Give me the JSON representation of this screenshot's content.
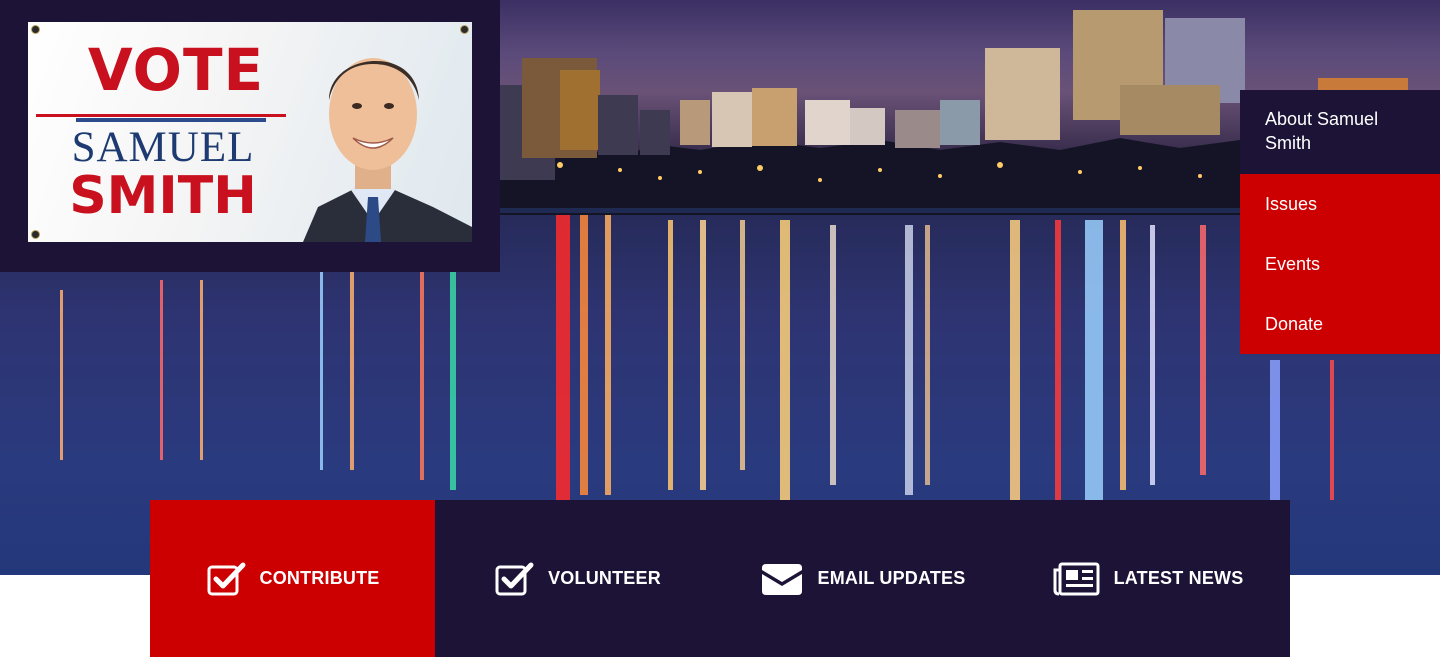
{
  "colors": {
    "navy": "#1d1336",
    "red": "#cc0000",
    "white": "#ffffff"
  },
  "logo": {
    "line1": "VOTE",
    "line2": "SAMUEL",
    "line3": "SMITH"
  },
  "nav": {
    "items": [
      {
        "label": "About Samuel Smith"
      },
      {
        "label": "Issues"
      },
      {
        "label": "Events"
      },
      {
        "label": "Donate"
      }
    ]
  },
  "actions": [
    {
      "label": "CONTRIBUTE",
      "icon": "checkbox-icon"
    },
    {
      "label": "VOLUNTEER",
      "icon": "checkbox-icon"
    },
    {
      "label": "EMAIL UPDATES",
      "icon": "envelope-icon"
    },
    {
      "label": "LATEST NEWS",
      "icon": "newspaper-icon"
    }
  ]
}
